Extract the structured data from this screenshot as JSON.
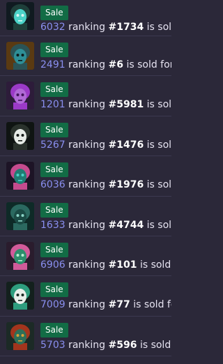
{
  "sales": [
    {
      "badge": "Sale",
      "value": "6032",
      "ranking_word": "ranking",
      "rank": "#1734",
      "suffix": "is sold",
      "colors": {
        "bg": "#101a20",
        "hair": "#1f3f3a",
        "face": "#4bd3c8",
        "accent": "#d8f5f2"
      }
    },
    {
      "badge": "Sale",
      "value": "2491",
      "ranking_word": "ranking",
      "rank": "#6",
      "suffix": "is sold for",
      "colors": {
        "bg": "#5a3a12",
        "hair": "#2b5356",
        "face": "#2e8f97",
        "accent": "#0d1a1c"
      }
    },
    {
      "badge": "Sale",
      "value": "1201",
      "ranking_word": "ranking",
      "rank": "#5981",
      "suffix": "is sold",
      "colors": {
        "bg": "#2d1c3a",
        "hair": "#9b3ac7",
        "face": "#b06ad6",
        "accent": "#43145d"
      }
    },
    {
      "badge": "Sale",
      "value": "5267",
      "ranking_word": "ranking",
      "rank": "#1476",
      "suffix": "is sold",
      "colors": {
        "bg": "#0f1412",
        "hair": "#2a322c",
        "face": "#e7ece7",
        "accent": "#151a17"
      }
    },
    {
      "badge": "Sale",
      "value": "6036",
      "ranking_word": "ranking",
      "rank": "#1976",
      "suffix": "is sold",
      "colors": {
        "bg": "#1d1426",
        "hair": "#c54b8e",
        "face": "#1f7d73",
        "accent": "#4bd3c8"
      }
    },
    {
      "badge": "Sale",
      "value": "1633",
      "ranking_word": "ranking",
      "rank": "#4744",
      "suffix": "is sold",
      "colors": {
        "bg": "#0e2a27",
        "hair": "#2b6960",
        "face": "#1a4a44",
        "accent": "#8bd4c7"
      }
    },
    {
      "badge": "Sale",
      "value": "6906",
      "ranking_word": "ranking",
      "rank": "#101",
      "suffix": "is sold fo",
      "colors": {
        "bg": "#2a1c2d",
        "hair": "#d25b9a",
        "face": "#2d8f6c",
        "accent": "#b6f0d4"
      }
    },
    {
      "badge": "Sale",
      "value": "7009",
      "ranking_word": "ranking",
      "rank": "#77",
      "suffix": "is sold fo",
      "colors": {
        "bg": "#13201d",
        "hair": "#2e9d7e",
        "face": "#e9eeea",
        "accent": "#1a2a24"
      }
    },
    {
      "badge": "Sale",
      "value": "5703",
      "ranking_word": "ranking",
      "rank": "#596",
      "suffix": "is sold f",
      "colors": {
        "bg": "#1c2a26",
        "hair": "#a3351d",
        "face": "#2e6f58",
        "accent": "#d6a23a"
      }
    }
  ]
}
